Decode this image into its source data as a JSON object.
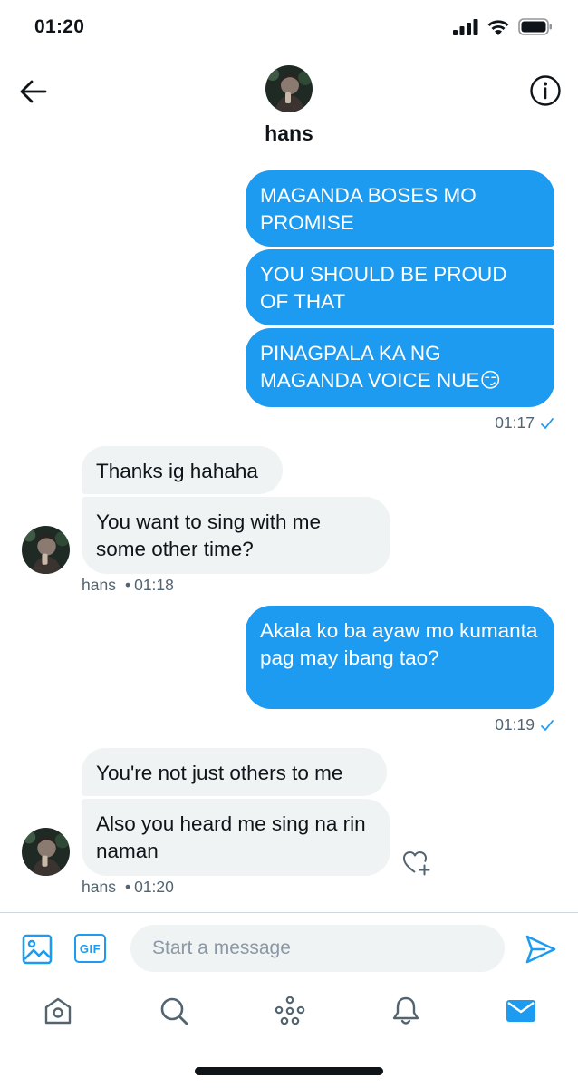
{
  "status_bar": {
    "time": "01:20"
  },
  "conversation": {
    "name": "hans",
    "avatar_icon": "profile-photo"
  },
  "messages": {
    "group1": {
      "m1": "MAGANDA BOSES MO PROMISE",
      "m2": "YOU SHOULD BE PROUD OF THAT",
      "m3": "PINAGPALA KA NG MAGANDA VOICE NUE😏",
      "time": "01:17"
    },
    "group2": {
      "m1": "Thanks ig hahaha",
      "m2": "You want to sing with me some other time?",
      "sender": "hans",
      "time": "01:18"
    },
    "group3": {
      "m1": "Akala ko ba ayaw mo kumanta pag may ibang tao?",
      "time": "01:19"
    },
    "group4": {
      "m1": "You're not just others to me",
      "m2": "Also you heard me sing na rin naman",
      "sender": "hans",
      "time": "01:20"
    }
  },
  "composer": {
    "placeholder": "Start a message",
    "gif_label": "GIF"
  },
  "colors": {
    "accent": "#1d9bf0",
    "incoming_bubble": "#eff3f4",
    "meta_text": "#536471"
  },
  "icons": [
    "back-arrow-icon",
    "info-icon",
    "image-icon",
    "gif-icon",
    "send-icon",
    "home-icon",
    "search-icon",
    "spaces-icon",
    "bell-icon",
    "mail-icon",
    "heart-plus-icon",
    "check-icon"
  ]
}
